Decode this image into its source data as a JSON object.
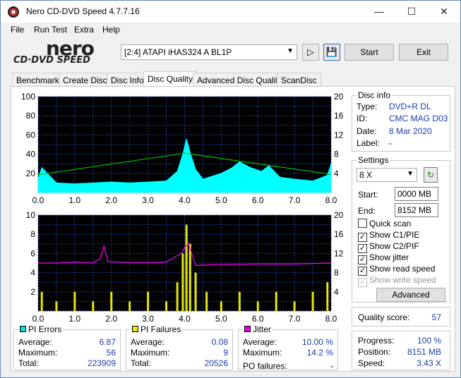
{
  "window": {
    "title": "Nero CD-DVD Speed 4.7.7.16"
  },
  "menu": [
    "File",
    "Run Test",
    "Extra",
    "Help"
  ],
  "logo": {
    "brand": "nero",
    "product": "CD·DVD SPEED"
  },
  "toolbar": {
    "drive": "[2:4]   ATAPI iHAS324   A BL1P",
    "start_label": "Start",
    "exit_label": "Exit"
  },
  "tabs": [
    "Benchmark",
    "Create Disc",
    "Disc Info",
    "Disc Quality",
    "Advanced Disc Quality",
    "ScanDisc"
  ],
  "active_tab": "Disc Quality",
  "disc_info": {
    "title": "Disc info",
    "type_label": "Type:",
    "type": "DVD+R DL",
    "id_label": "ID:",
    "id": "CMC MAG D03",
    "date_label": "Date:",
    "date": "8 Mar 2020",
    "label_label": "Label:",
    "label": "-"
  },
  "settings": {
    "title": "Settings",
    "speed": "8 X",
    "start_label": "Start:",
    "start": "0000 MB",
    "end_label": "End:",
    "end": "8152 MB",
    "quick_scan": "Quick scan",
    "show_c1": "Show C1/PIE",
    "show_c2": "Show C2/PIF",
    "show_jitter": "Show jitter",
    "show_read": "Show read speed",
    "show_write": "Show write speed",
    "advanced_label": "Advanced"
  },
  "quality": {
    "label": "Quality score:",
    "value": "57"
  },
  "progress": {
    "progress_label": "Progress:",
    "progress": "100 %",
    "position_label": "Position:",
    "position": "8151 MB",
    "speed_label": "Speed:",
    "speed": "3.43 X"
  },
  "stats": {
    "pi_errors": {
      "title": "PI Errors",
      "avg_label": "Average:",
      "avg": "6.87",
      "max_label": "Maximum:",
      "max": "56",
      "total_label": "Total:",
      "total": "223909",
      "color": "#00e0e0"
    },
    "pi_failures": {
      "title": "PI Failures",
      "avg_label": "Average:",
      "avg": "0.08",
      "max_label": "Maximum:",
      "max": "9",
      "total_label": "Total:",
      "total": "20526",
      "color": "#e8e800"
    },
    "jitter": {
      "title": "Jitter",
      "avg_label": "Average:",
      "avg": "10.00 %",
      "max_label": "Maximum:",
      "max": "14.2 %",
      "po_label": "PO failures:",
      "po": "-",
      "color": "#e800e8"
    }
  },
  "chart_data": [
    {
      "type": "area",
      "name": "PI Errors",
      "x_ticks": [
        "0.0",
        "1.0",
        "2.0",
        "3.0",
        "4.0",
        "5.0",
        "6.0",
        "7.0",
        "8.0"
      ],
      "y_left_ticks": [
        "100",
        "80",
        "60",
        "40",
        "20"
      ],
      "y_right_ticks": [
        "20",
        "16",
        "12",
        "8",
        "4"
      ],
      "xlim": [
        0,
        8
      ],
      "ylim": [
        0,
        100
      ],
      "y2lim": [
        0,
        20
      ],
      "series": [
        {
          "color": "#00ffff",
          "x": [
            0,
            0.1,
            0.5,
            1,
            1.5,
            2,
            2.5,
            3,
            3.5,
            3.8,
            3.95,
            4.05,
            4.15,
            4.3,
            4.5,
            5,
            5.3,
            5.5,
            5.8,
            6.1,
            6.3,
            6.6,
            7,
            7.5,
            7.9,
            8
          ],
          "y": [
            14,
            26,
            10,
            9,
            10,
            11,
            10,
            11,
            12,
            22,
            40,
            56,
            42,
            24,
            14,
            20,
            26,
            32,
            26,
            22,
            28,
            16,
            14,
            12,
            18,
            30
          ]
        },
        {
          "color": "#00c000",
          "x": [
            0,
            4,
            8
          ],
          "y": [
            3.7,
            8.2,
            3.8
          ]
        }
      ]
    },
    {
      "type": "bar",
      "name": "PI Failures / Jitter",
      "x_ticks": [
        "0.0",
        "1.0",
        "2.0",
        "3.0",
        "4.0",
        "5.0",
        "6.0",
        "7.0",
        "8.0"
      ],
      "y_left_ticks": [
        "10",
        "8",
        "6",
        "4",
        "2"
      ],
      "y_right_ticks": [
        "20",
        "16",
        "12",
        "8",
        "4"
      ],
      "xlim": [
        0,
        8
      ],
      "ylim": [
        0,
        10
      ],
      "y2lim": [
        0,
        20
      ],
      "series": [
        {
          "color": "#e8e800",
          "x": [
            0.1,
            0.5,
            1,
            1.5,
            2,
            2.5,
            3,
            3.5,
            3.8,
            3.95,
            4.05,
            4.15,
            4.3,
            4.6,
            5,
            5.5,
            6,
            6.5,
            7,
            7.5,
            7.9
          ],
          "y": [
            2,
            1,
            2,
            1,
            2,
            1,
            2,
            1,
            3,
            6,
            9,
            7,
            4,
            2,
            1,
            2,
            1,
            2,
            1,
            2,
            3
          ]
        },
        {
          "color": "#ff00ff",
          "x": [
            0,
            0.5,
            1,
            1.5,
            1.7,
            1.8,
            1.9,
            2.5,
            3,
            3.5,
            3.9,
            4.1,
            4.3,
            4.6,
            5,
            6,
            7,
            8
          ],
          "y": [
            10,
            10,
            10.2,
            10,
            11,
            13.5,
            10.3,
            10.1,
            10.1,
            10.2,
            12,
            14.2,
            9.5,
            9.6,
            9.7,
            9.8,
            9.8,
            10
          ]
        }
      ]
    }
  ]
}
